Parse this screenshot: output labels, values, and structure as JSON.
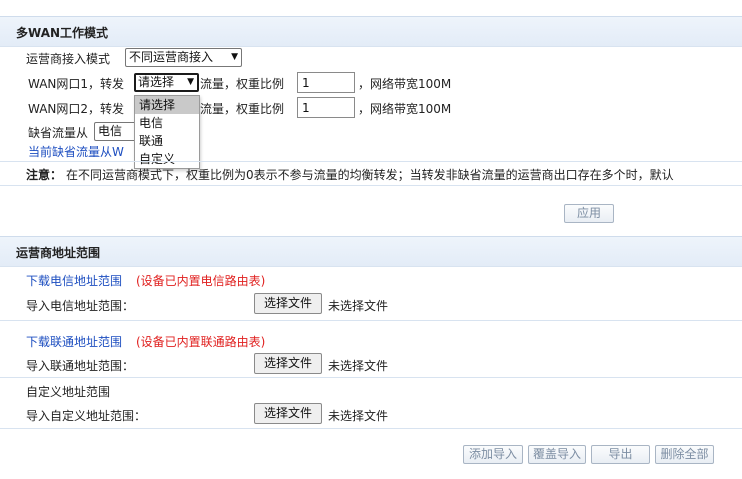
{
  "wan_mode": {
    "section_title": "多WAN工作模式",
    "isp_mode_label": "运营商接入模式",
    "isp_mode_value": "不同运营商接入",
    "wan1": {
      "prefix": "WAN网口1，转发",
      "select_value": "请选择",
      "middle": "流量，权重比例",
      "weight": "1",
      "suffix": "，网络带宽100M"
    },
    "wan2": {
      "prefix": "WAN网口2，转发",
      "middle": "流量，权重比例",
      "weight": "1",
      "suffix": "，网络带宽100M"
    },
    "dropdown_options": [
      "请选择",
      "电信",
      "联通",
      "自定义"
    ],
    "default_label": "缺省流量从",
    "default_value": "电信",
    "current_default_text": "当前缺省流量从W",
    "note_label": "注意：",
    "note_text": "在不同运营商模式下，权重比例为0表示不参与流量的均衡转发；当转发非缺省流量的运营商出口存在多个时，默认",
    "apply_label": "应用"
  },
  "isp_range": {
    "section_title": "运营商地址范围",
    "telecom_download": "下载电信地址范围",
    "telecom_builtin": "(设备已内置电信路由表)",
    "telecom_import_label": "导入电信地址范围：",
    "unicom_download": "下载联通地址范围",
    "unicom_builtin": "(设备已内置联通路由表)",
    "unicom_import_label": "导入联通地址范围：",
    "custom_title": "自定义地址范围",
    "custom_import_label": "导入自定义地址范围：",
    "choose_file_label": "选择文件",
    "no_file_label": "未选择文件",
    "buttons": {
      "add_import": "添加导入",
      "overwrite_import": "覆盖导入",
      "export": "导出",
      "delete_all": "删除全部"
    }
  }
}
